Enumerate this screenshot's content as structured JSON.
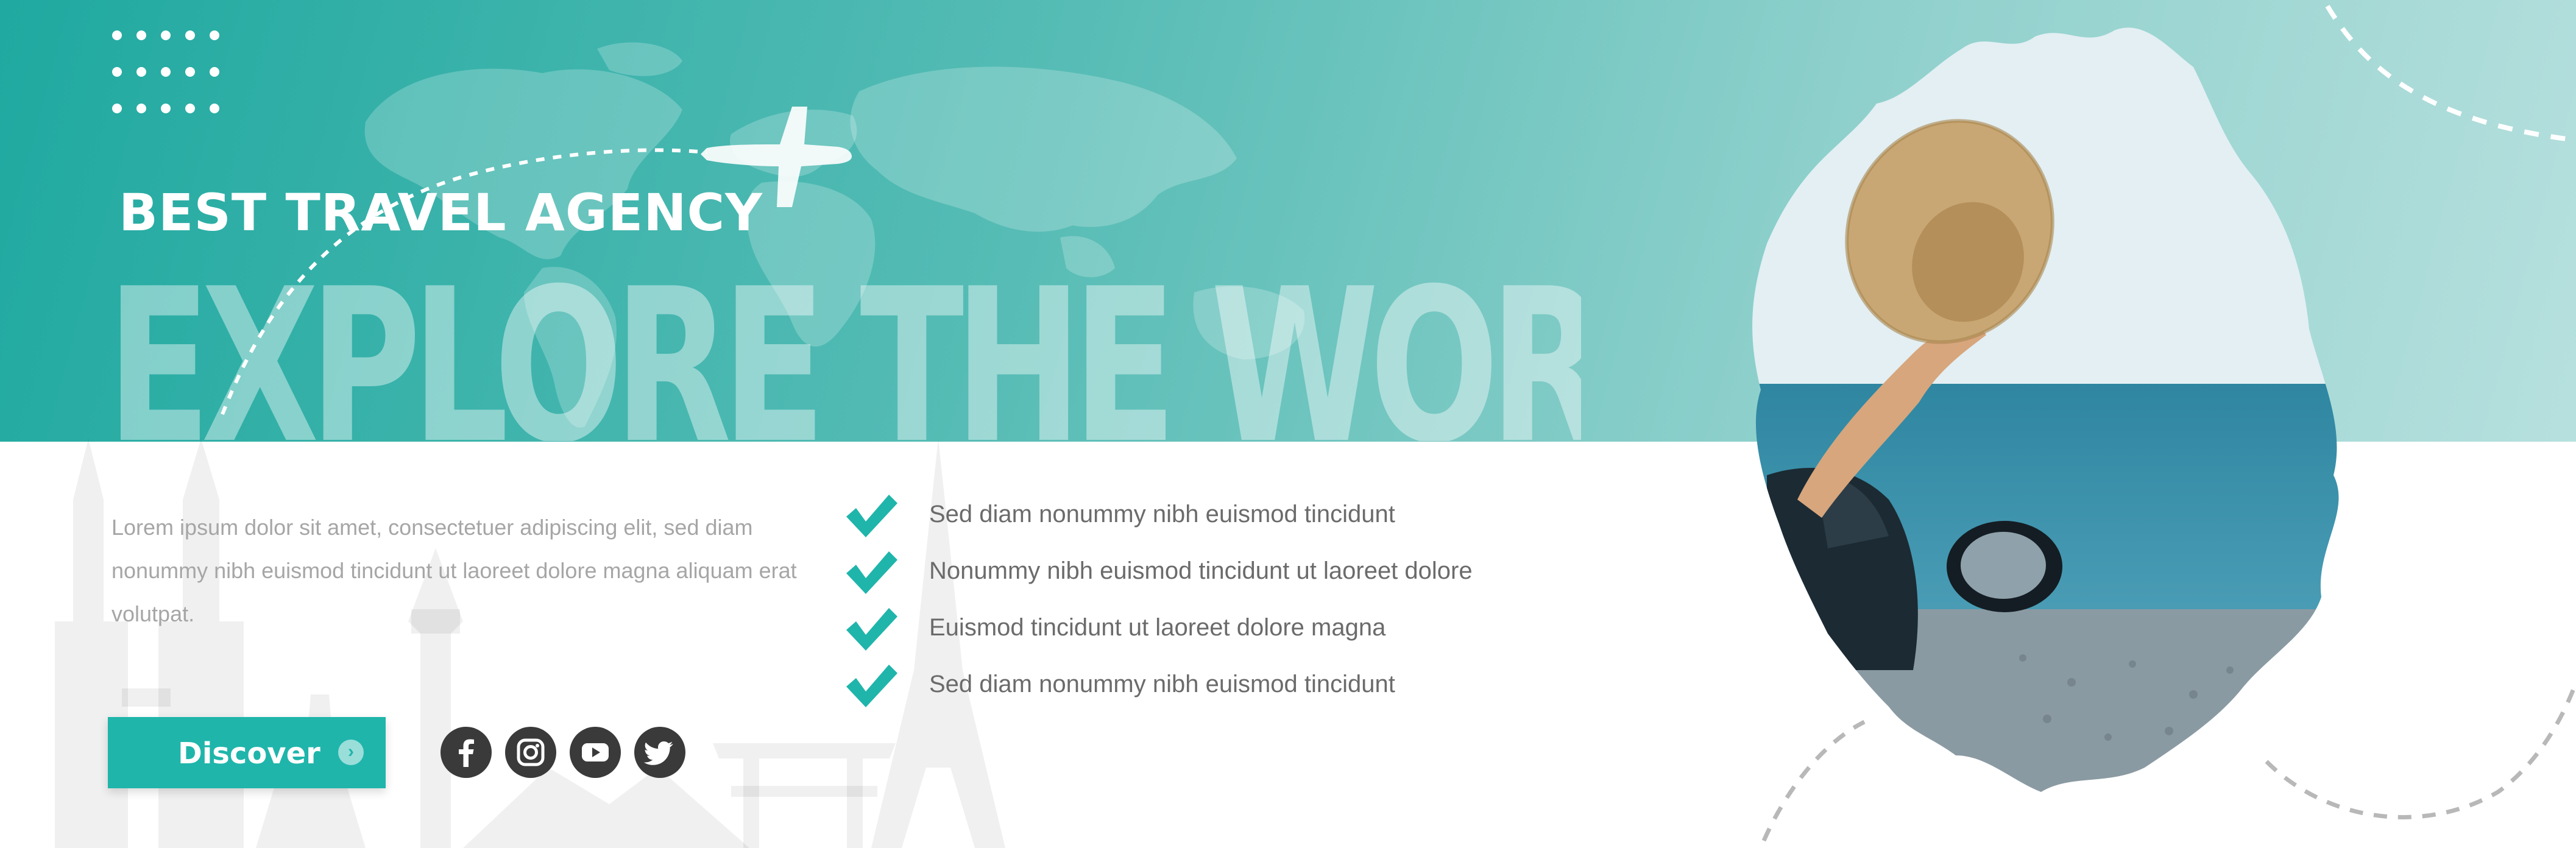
{
  "hero": {
    "eyebrow": "BEST TRAVEL AGENCY",
    "headline": "EXPLORE THE WORLD"
  },
  "intro": {
    "text": "Lorem ipsum dolor sit amet, consectetuer adipiscing elit, sed diam nonummy nibh euismod tincidunt ut laoreet dolore magna aliquam erat volutpat."
  },
  "features": [
    {
      "text": "Sed diam nonummy nibh euismod tincidunt"
    },
    {
      "text": "Nonummy nibh euismod tincidunt ut laoreet dolore"
    },
    {
      "text": "Euismod tincidunt ut laoreet dolore magna"
    },
    {
      "text": "Sed diam nonummy nibh euismod tincidunt"
    }
  ],
  "cta": {
    "label": "Discover",
    "chevron": "›"
  },
  "social": {
    "icons": [
      "facebook-icon",
      "instagram-icon",
      "youtube-icon",
      "twitter-icon"
    ]
  },
  "colors": {
    "accent": "#1fb5ab",
    "band_start": "#1fa9a0",
    "band_end": "#b6e0de",
    "icon_dark": "#3a3a3a",
    "body_text": "#6b6b6b",
    "muted_text": "#a6a6a6"
  },
  "decor": {
    "icons": [
      "world-map",
      "airplane-icon",
      "dot-grid",
      "skyline",
      "check-icon"
    ]
  }
}
